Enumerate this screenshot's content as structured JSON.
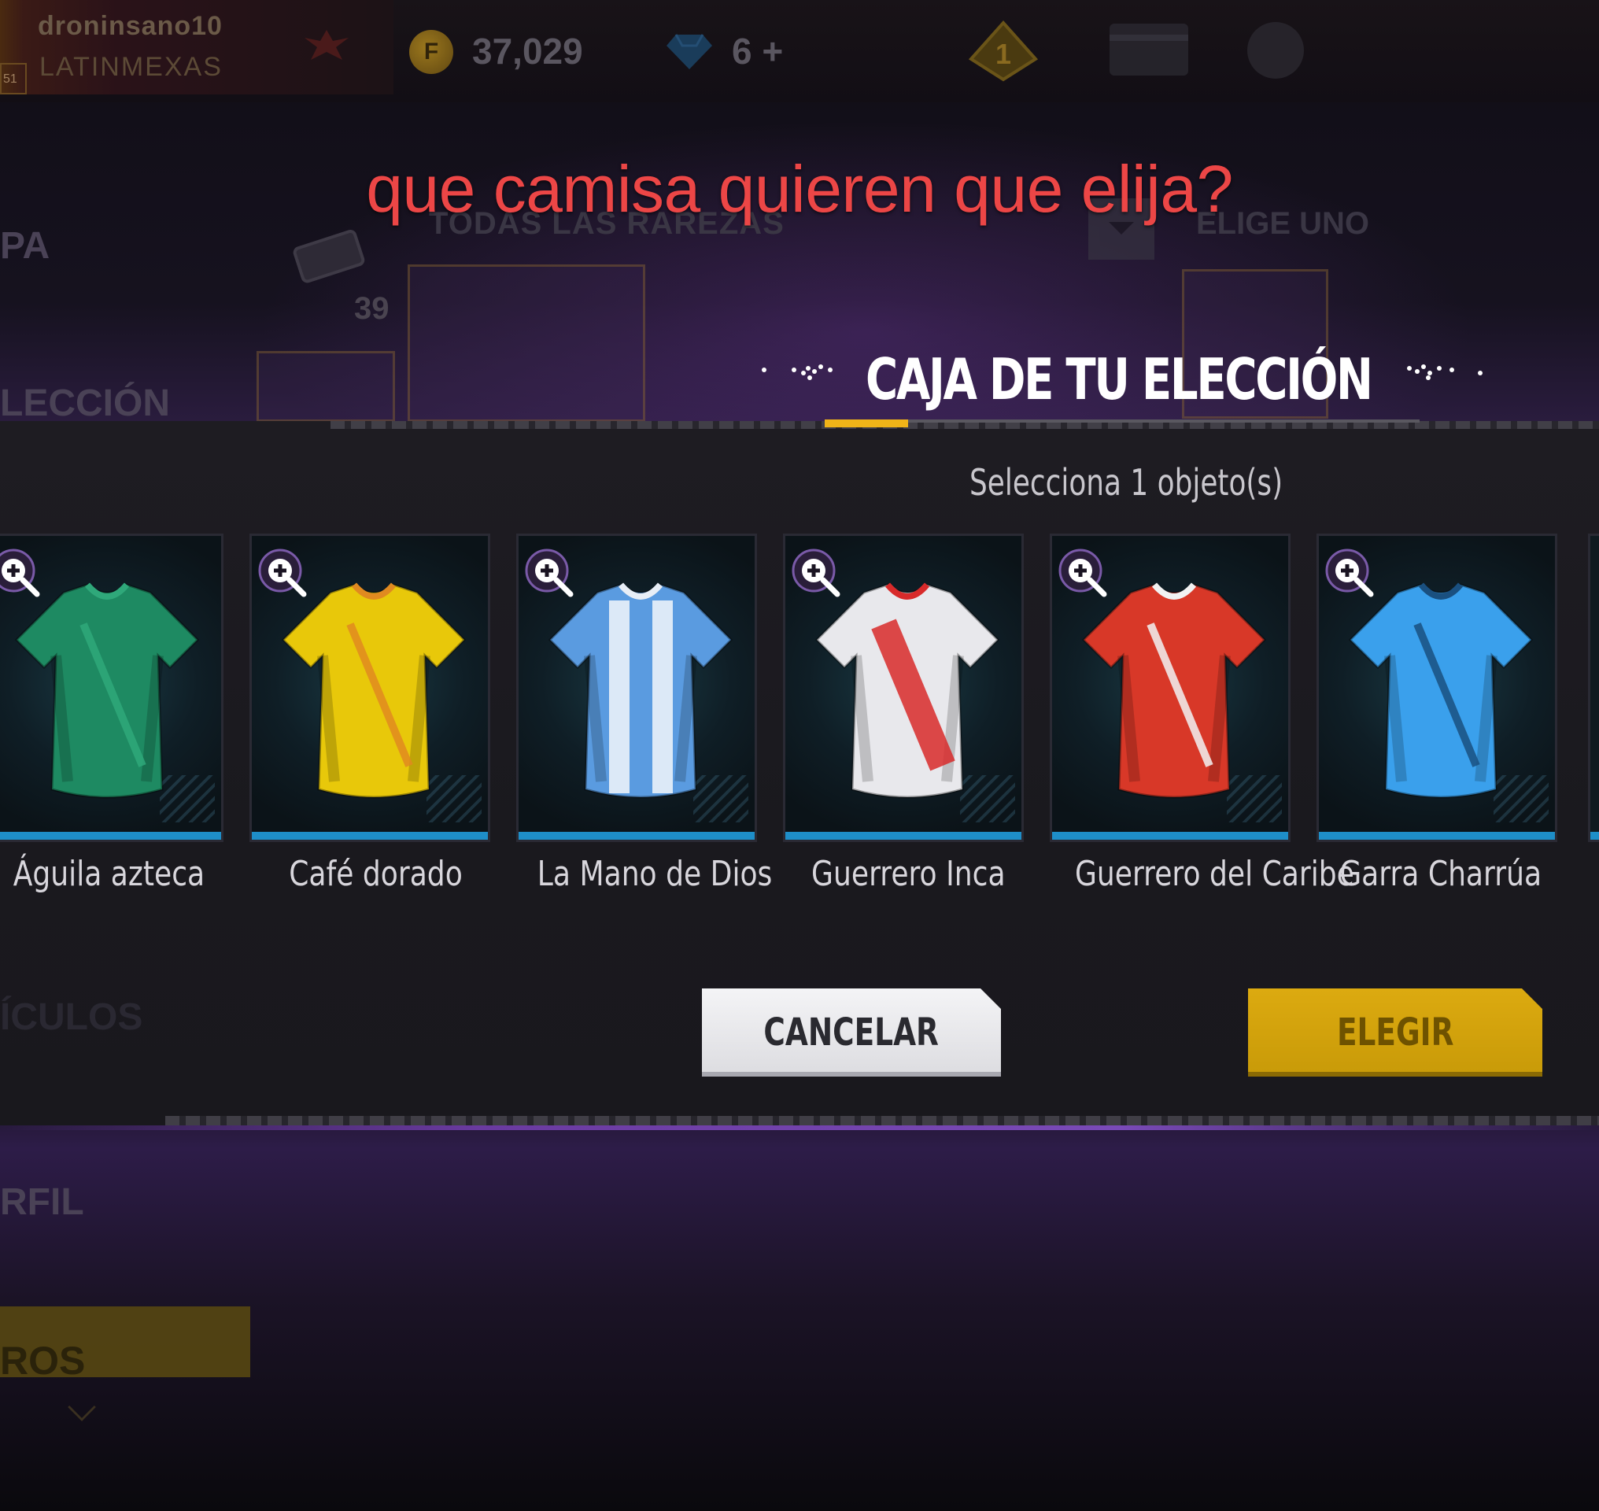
{
  "caption": "que camisa quieren que elija?",
  "background": {
    "username": "droninsano10",
    "clan": "LATINMEXAS",
    "level": "51",
    "coins": "37,029",
    "diamonds": "6 +",
    "side_labels": [
      "PA",
      "LECCIÓN",
      "ÍCULOS",
      "RFIL",
      "ROS"
    ],
    "count": "39",
    "rarezas": "TODAS LAS RAREZAS",
    "elige": "ELIGE UNO"
  },
  "dialog": {
    "title": "CAJA DE TU ELECCIÓN",
    "subtitle": "Selecciona 1 objeto(s)",
    "items": [
      {
        "label": "Águila azteca",
        "shirt_color": "#1e8a62",
        "accent": "#2fa87a"
      },
      {
        "label": "Café dorado",
        "shirt_color": "#e8c80a",
        "accent": "#e08a20"
      },
      {
        "label": "La Mano de Dios",
        "shirt_color": "#5a9be0",
        "accent": "#e8eef6"
      },
      {
        "label": "Guerrero Inca",
        "shirt_color": "#e8e8ec",
        "accent": "#d82a2a"
      },
      {
        "label": "Guerrero del Caribe",
        "shirt_color": "#d83828",
        "accent": "#f2f2f2"
      },
      {
        "label": "Garra Charrúa",
        "shirt_color": "#3aa0ec",
        "accent": "#1a5080"
      }
    ],
    "cancel_label": "CANCELAR",
    "choose_label": "ELEGIR"
  },
  "colors": {
    "caption": "#ec4646",
    "accent_gold": "#f0b418",
    "card_bar": "#1e8ec8"
  }
}
